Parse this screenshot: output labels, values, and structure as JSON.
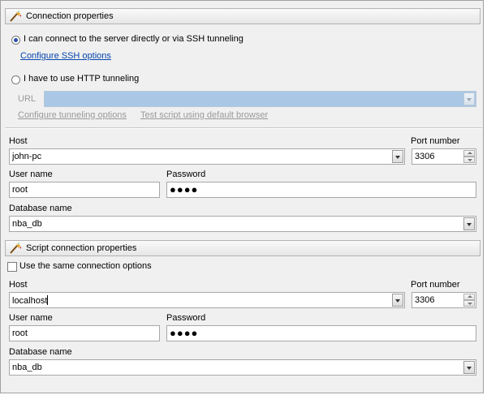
{
  "connection": {
    "header": "Connection properties",
    "option_direct": "I can connect to the server directly or via SSH tunneling",
    "ssh_link": "Configure SSH options",
    "option_http": "I have to use HTTP tunneling",
    "url_label": "URL",
    "configure_tunneling_link": "Configure tunneling options",
    "test_script_link": "Test script using default browser",
    "host_label": "Host",
    "host_value": "john-pc",
    "port_label": "Port number",
    "port_value": "3306",
    "user_label": "User name",
    "user_value": "root",
    "password_label": "Password",
    "password_mask": "●●●●",
    "db_label": "Database name",
    "db_value": "nba_db"
  },
  "script": {
    "header": "Script connection properties",
    "same_options_label": "Use the same connection options",
    "host_label": "Host",
    "host_value": "localhost",
    "port_label": "Port number",
    "port_value": "3306",
    "user_label": "User name",
    "user_value": "root",
    "password_label": "Password",
    "password_mask": "●●●●",
    "db_label": "Database name",
    "db_value": "nba_db"
  },
  "colors": {
    "link": "#0645ad",
    "url_field_disabled": "#aac8e6",
    "radio_selected": "#2b4fa8"
  }
}
